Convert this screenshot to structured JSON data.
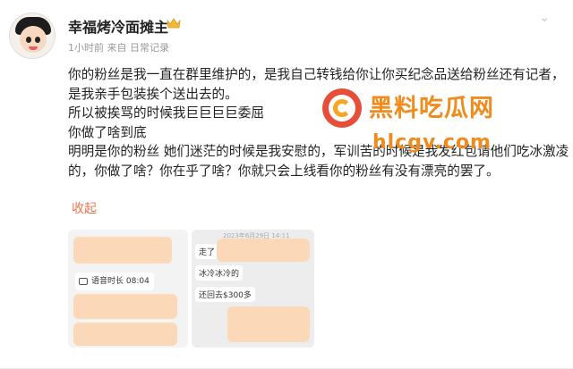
{
  "post": {
    "author": "幸福烤冷面摊主",
    "meta": "1小时前  来自  日常记录",
    "paragraphs": [
      "你的粉丝是我一直在群里维护的，是我自己转钱给你让你买纪念品送给粉丝还有记者，是我亲手包装挨个送出去的。",
      "所以被挨骂的时候我巨巨巨巨委屈",
      "你做了啥到底",
      "明明是你的粉丝 她们迷茫的时候是我安慰的，军训苦的时候是我发红包请他们吃冰激凌的，你做了啥？你在乎了啥？你就只会上线看你的粉丝有没有漂亮的罢了。"
    ],
    "collapse_label": "收起"
  },
  "images": {
    "call_label": "语音时长 08:04",
    "timestamp": "2023年6月29日 14:11",
    "chat_lines": [
      "走了",
      "冰冷冰冷的",
      "还回去$300多"
    ]
  },
  "watermark": {
    "title": "黑料吃瓜网",
    "url": "hlcgv.com"
  }
}
